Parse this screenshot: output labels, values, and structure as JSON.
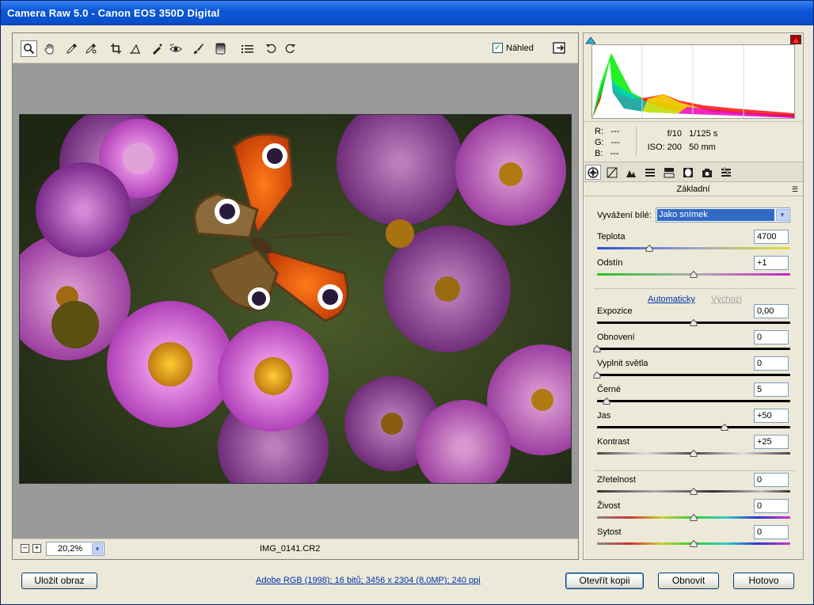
{
  "window": {
    "title": "Camera Raw 5.0  -  Canon EOS 350D Digital"
  },
  "toolbar": {
    "tools": [
      "zoom-icon",
      "hand-icon",
      "eyedropper-icon",
      "color-sampler-icon",
      "crop-icon",
      "straighten-icon",
      "spot-removal-icon",
      "red-eye-icon",
      "adjustment-brush-icon",
      "graduated-filter-icon",
      "preferences-icon",
      "rotate-left-icon",
      "rotate-right-icon"
    ],
    "preview_label": "Náhled",
    "preview_checked": true
  },
  "status": {
    "zoom": "20,2%",
    "filename": "IMG_0141.CR2"
  },
  "info": {
    "r_label": "R:",
    "r_value": "---",
    "g_label": "G:",
    "g_value": "---",
    "b_label": "B:",
    "b_value": "---",
    "aperture": "f/10",
    "shutter": "1/125 s",
    "iso": "ISO: 200",
    "focal": "50 mm"
  },
  "panel": {
    "title": "Základní",
    "wb_label": "Vyvážení bílé:",
    "wb_value": "Jako snímek",
    "auto_link": "Automaticky",
    "default_link": "Výchozí",
    "sliders": [
      {
        "key": "temp",
        "label": "Teplota",
        "value": "4700",
        "pos": 0.27
      },
      {
        "key": "tint",
        "label": "Odstín",
        "value": "+1",
        "pos": 0.5
      },
      {
        "key": "exposure",
        "label": "Expozice",
        "value": "0,00",
        "pos": 0.5
      },
      {
        "key": "recovery",
        "label": "Obnovení",
        "value": "0",
        "pos": 0.0
      },
      {
        "key": "fill",
        "label": "Vyplnit světla",
        "value": "0",
        "pos": 0.0
      },
      {
        "key": "blacks",
        "label": "Černé",
        "value": "5",
        "pos": 0.05
      },
      {
        "key": "brightness",
        "label": "Jas",
        "value": "+50",
        "pos": 0.66
      },
      {
        "key": "contrast",
        "label": "Kontrast",
        "value": "+25",
        "pos": 0.5
      },
      {
        "key": "clarity",
        "label": "Zřetelnost",
        "value": "0",
        "pos": 0.5
      },
      {
        "key": "vibrance",
        "label": "Živost",
        "value": "0",
        "pos": 0.5
      },
      {
        "key": "saturation",
        "label": "Sytost",
        "value": "0",
        "pos": 0.5
      }
    ]
  },
  "footer": {
    "save_label": "Uložit obraz",
    "workflow_link": "Adobe RGB (1998); 16 bitů; 3456 x 2304 (8,0MP); 240 ppi",
    "open_copy_label": "Otevřít kopii",
    "reset_label": "Obnovit",
    "done_label": "Hotovo"
  },
  "colors": {
    "accent": "#316ac5",
    "title_bar": "#0a57d8"
  }
}
